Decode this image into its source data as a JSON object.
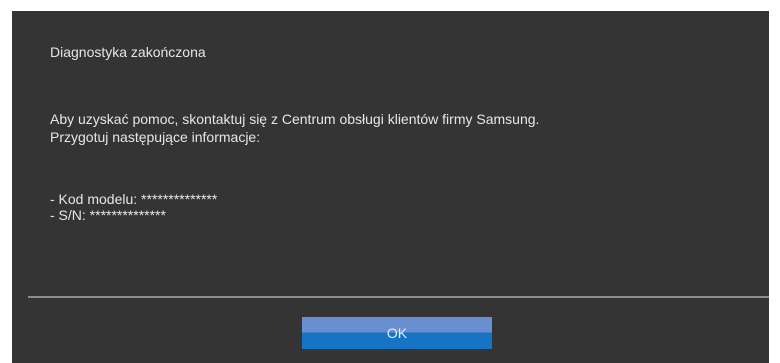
{
  "dialog": {
    "title": "Diagnostyka zakończona",
    "message_line1": "Aby uzyskać pomoc, skontaktuj się z Centrum obsługi klientów firmy Samsung.",
    "message_line2": "Przygotuj następujące informacje:",
    "info_model": "- Kod modelu: **************",
    "info_serial": "- S/N: **************",
    "ok_label": "OK"
  },
  "colors": {
    "dialog_background": "#343434",
    "text": "#e6e6e6",
    "divider": "#8c8c8c",
    "button_top": "#6a8fd0",
    "button_bottom": "#1773c4"
  }
}
